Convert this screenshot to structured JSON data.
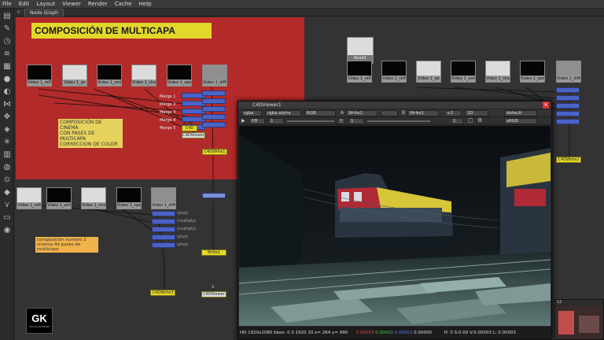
{
  "menubar": [
    "File",
    "Edit",
    "Layout",
    "Viewer",
    "Render",
    "Cache",
    "Help"
  ],
  "tab": {
    "close": "×",
    "label": "Node Graph"
  },
  "graph": {
    "backdrop_title": "COMPOSICIÓN DE MULTICAPA",
    "sticky_main": [
      "COMPOSICIÓN DE CINEMA",
      "CON PASES DE MULTICAPA",
      "CORRECCION DE COLOR"
    ],
    "sticky_second": [
      "composición numero 2",
      "cinema 4d pases de multicapa"
    ],
    "top_nodes": [
      {
        "label": "Video 1_refl",
        "tone": "dark"
      },
      {
        "label": "Video 1_ao",
        "tone": "light"
      },
      {
        "label": "Video 1_ambient",
        "tone": "dark"
      },
      {
        "label": "Video 1_shadow",
        "tone": "light"
      },
      {
        "label": "Video 1_specul",
        "tone": "dark"
      },
      {
        "label": "Video 1_diffuse",
        "tone": "mid"
      }
    ],
    "mid_nodes": [
      {
        "label": "Video 1_refl",
        "tone": "light"
      },
      {
        "label": "Video 1_ambient",
        "tone": "dark"
      },
      {
        "label": "Video 1_shadow",
        "tone": "light"
      },
      {
        "label": "Video 1_specul",
        "tone": "dark"
      },
      {
        "label": "Video 1_diffuse",
        "tone": "mid"
      }
    ],
    "right_nodes": [
      {
        "label": "Video 1_refl",
        "tone": "dark"
      },
      {
        "label": "Video 1_refl",
        "tone": "dark"
      },
      {
        "label": "Video 1_ao",
        "tone": "light"
      },
      {
        "label": "Video 1_ambient",
        "tone": "dark"
      },
      {
        "label": "Video 1_shadow",
        "tone": "light"
      },
      {
        "label": "Video 1_specul",
        "tone": "dark"
      },
      {
        "label": "Video 1_diffuse",
        "tone": "mid"
      }
    ],
    "read1": "Read1",
    "merge_labels": [
      "Merge 1",
      "Merge 2",
      "Merge 3",
      "Merge 4",
      "Merge 5"
    ],
    "c4d_write_1": "C4DWrite1",
    "c4d_write_2": "C4DWrite2",
    "c4d_write_3": "C4DWrite3",
    "write1": "Write1",
    "write2": "Write2",
    "c4d_viewer": "C4DViewer",
    "c4d_label": "C4D",
    "plus_labels": [
      "(plus)",
      "(multiply)",
      "(multiply)",
      "(plus)",
      "(plus)"
    ],
    "link_numbers": [
      "1",
      "2"
    ]
  },
  "viewer": {
    "title": "C4DViewer1",
    "row1": [
      "rgba",
      "rgba.alpha",
      "RGB",
      "A",
      "Write2",
      "-",
      "B",
      "Write1",
      "+2",
      "2D",
      "default"
    ],
    "row2": [
      "f/8",
      "1",
      "Y",
      "1",
      "1",
      "sRGB"
    ],
    "status": {
      "res": "HD 1920x1080",
      "bbox": "bbox: 0 0 1920 10",
      "coords": "x= 264 y= 990",
      "r": "0.00003",
      "g": "0.00003",
      "b": "0.00003",
      "a": "0.00000",
      "hsv": "H: 0 S:0.00 V:0.00003",
      "l": "L: 0.00003"
    }
  },
  "logo": {
    "text": "GK",
    "sub": "VISUALIZACIONES"
  },
  "mini": {
    "label": "12"
  },
  "colors": {
    "backdrop": "#b22a2a",
    "title": "#e3d72a",
    "merge": "#4b63c7",
    "write": "#e3d92a"
  }
}
